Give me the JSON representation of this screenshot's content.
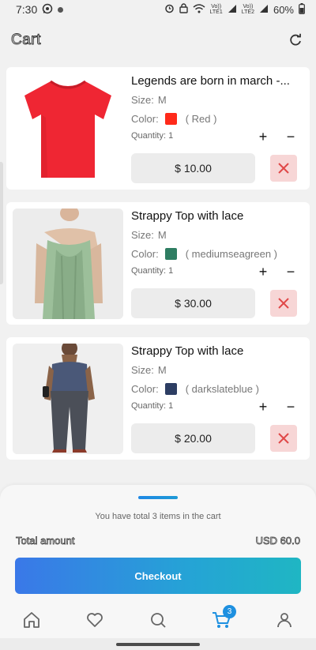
{
  "status_bar": {
    "time": "7:30",
    "battery": "60%",
    "lte1": "LTE1",
    "lte2": "LTE2",
    "volte": "Vo))"
  },
  "header": {
    "title": "Cart"
  },
  "items": [
    {
      "title": "Legends are born in march -...",
      "size_label": "Size:",
      "size": "M",
      "color_label": "Color:",
      "color_name": "( Red )",
      "color_hex": "#ff2a1a",
      "qty_label": "Quantity:",
      "quantity": "1",
      "plus": "+",
      "minus": "−",
      "price": "$ 10.00"
    },
    {
      "title": "Strappy Top with lace",
      "size_label": "Size:",
      "size": "M",
      "color_label": "Color:",
      "color_name": "( mediumseagreen )",
      "color_hex": "#2e7d62",
      "qty_label": "Quantity:",
      "quantity": "1",
      "plus": "+",
      "minus": "−",
      "price": "$ 30.00"
    },
    {
      "title": "Strappy Top with lace",
      "size_label": "Size:",
      "size": "M",
      "color_label": "Color:",
      "color_name": "( darkslateblue )",
      "color_hex": "#2d3e63",
      "qty_label": "Quantity:",
      "quantity": "1",
      "plus": "+",
      "minus": "−",
      "price": "$ 20.00"
    }
  ],
  "summary": {
    "note": "You have total 3 items in the cart",
    "total_label": "Total amount",
    "total_value": "USD 60.0",
    "checkout_label": "Checkout"
  },
  "nav": {
    "cart_badge": "3",
    "items": [
      "home-icon",
      "heart-icon",
      "search-icon",
      "cart-icon",
      "profile-icon"
    ]
  },
  "colors": {
    "accent": "#1e90e0",
    "remove_bg": "#f7d6d6",
    "remove_x": "#e04848"
  }
}
